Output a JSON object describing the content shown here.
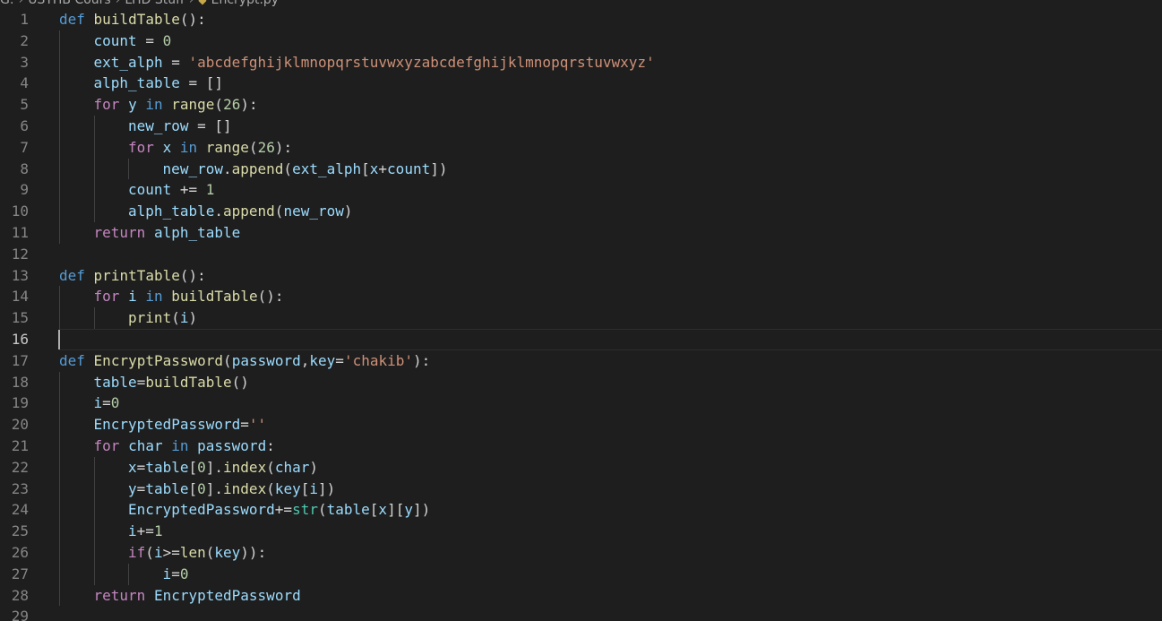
{
  "breadcrumb": {
    "path": [
      "G:",
      "USTHB Cours",
      "LHD Stuff"
    ],
    "file": "Encrypt.py"
  },
  "editor": {
    "current_line": 16,
    "lines": [
      {
        "n": "1",
        "indent": 0,
        "tokens": [
          [
            "kw",
            "def"
          ],
          [
            "pl",
            " "
          ],
          [
            "fn",
            "buildTable"
          ],
          [
            "pl",
            "():"
          ]
        ]
      },
      {
        "n": "2",
        "indent": 1,
        "tokens": [
          [
            "var",
            "count"
          ],
          [
            "pl",
            " = "
          ],
          [
            "num",
            "0"
          ]
        ]
      },
      {
        "n": "3",
        "indent": 1,
        "tokens": [
          [
            "var",
            "ext_alph"
          ],
          [
            "pl",
            " = "
          ],
          [
            "str",
            "'abcdefghijklmnopqrstuvwxyzabcdefghijklmnopqrstuvwxyz'"
          ]
        ]
      },
      {
        "n": "4",
        "indent": 1,
        "tokens": [
          [
            "var",
            "alph_table"
          ],
          [
            "pl",
            " = []"
          ]
        ]
      },
      {
        "n": "5",
        "indent": 1,
        "tokens": [
          [
            "ctl",
            "for"
          ],
          [
            "pl",
            " "
          ],
          [
            "var",
            "y"
          ],
          [
            "pl",
            " "
          ],
          [
            "kw",
            "in"
          ],
          [
            "pl",
            " "
          ],
          [
            "fn",
            "range"
          ],
          [
            "pl",
            "("
          ],
          [
            "num",
            "26"
          ],
          [
            "pl",
            "):"
          ]
        ]
      },
      {
        "n": "6",
        "indent": 2,
        "tokens": [
          [
            "var",
            "new_row"
          ],
          [
            "pl",
            " = []"
          ]
        ]
      },
      {
        "n": "7",
        "indent": 2,
        "tokens": [
          [
            "ctl",
            "for"
          ],
          [
            "pl",
            " "
          ],
          [
            "var",
            "x"
          ],
          [
            "pl",
            " "
          ],
          [
            "kw",
            "in"
          ],
          [
            "pl",
            " "
          ],
          [
            "fn",
            "range"
          ],
          [
            "pl",
            "("
          ],
          [
            "num",
            "26"
          ],
          [
            "pl",
            "):"
          ]
        ]
      },
      {
        "n": "8",
        "indent": 3,
        "tokens": [
          [
            "var",
            "new_row"
          ],
          [
            "pl",
            "."
          ],
          [
            "fn",
            "append"
          ],
          [
            "pl",
            "("
          ],
          [
            "var",
            "ext_alph"
          ],
          [
            "pl",
            "["
          ],
          [
            "var",
            "x"
          ],
          [
            "pl",
            "+"
          ],
          [
            "var",
            "count"
          ],
          [
            "pl",
            "])"
          ]
        ]
      },
      {
        "n": "9",
        "indent": 2,
        "tokens": [
          [
            "var",
            "count"
          ],
          [
            "pl",
            " += "
          ],
          [
            "num",
            "1"
          ]
        ]
      },
      {
        "n": "10",
        "indent": 2,
        "tokens": [
          [
            "var",
            "alph_table"
          ],
          [
            "pl",
            "."
          ],
          [
            "fn",
            "append"
          ],
          [
            "pl",
            "("
          ],
          [
            "var",
            "new_row"
          ],
          [
            "pl",
            ")"
          ]
        ]
      },
      {
        "n": "11",
        "indent": 1,
        "tokens": [
          [
            "ctl",
            "return"
          ],
          [
            "pl",
            " "
          ],
          [
            "var",
            "alph_table"
          ]
        ]
      },
      {
        "n": "12",
        "indent": 0,
        "tokens": []
      },
      {
        "n": "13",
        "indent": 0,
        "tokens": [
          [
            "kw",
            "def"
          ],
          [
            "pl",
            " "
          ],
          [
            "fn",
            "printTable"
          ],
          [
            "pl",
            "():"
          ]
        ]
      },
      {
        "n": "14",
        "indent": 1,
        "tokens": [
          [
            "ctl",
            "for"
          ],
          [
            "pl",
            " "
          ],
          [
            "var",
            "i"
          ],
          [
            "pl",
            " "
          ],
          [
            "kw",
            "in"
          ],
          [
            "pl",
            " "
          ],
          [
            "fn",
            "buildTable"
          ],
          [
            "pl",
            "():"
          ]
        ]
      },
      {
        "n": "15",
        "indent": 2,
        "tokens": [
          [
            "fn",
            "print"
          ],
          [
            "pl",
            "("
          ],
          [
            "var",
            "i"
          ],
          [
            "pl",
            ")"
          ]
        ]
      },
      {
        "n": "16",
        "indent": 0,
        "tokens": []
      },
      {
        "n": "17",
        "indent": 0,
        "tokens": [
          [
            "kw",
            "def"
          ],
          [
            "pl",
            " "
          ],
          [
            "fn",
            "EncryptPassword"
          ],
          [
            "pl",
            "("
          ],
          [
            "var",
            "password"
          ],
          [
            "pl",
            ","
          ],
          [
            "var",
            "key"
          ],
          [
            "pl",
            "="
          ],
          [
            "str",
            "'chakib'"
          ],
          [
            "pl",
            "):"
          ]
        ]
      },
      {
        "n": "18",
        "indent": 1,
        "tokens": [
          [
            "var",
            "table"
          ],
          [
            "pl",
            "="
          ],
          [
            "fn",
            "buildTable"
          ],
          [
            "pl",
            "()"
          ]
        ]
      },
      {
        "n": "19",
        "indent": 1,
        "tokens": [
          [
            "var",
            "i"
          ],
          [
            "pl",
            "="
          ],
          [
            "num",
            "0"
          ]
        ]
      },
      {
        "n": "20",
        "indent": 1,
        "tokens": [
          [
            "var",
            "EncryptedPassword"
          ],
          [
            "pl",
            "="
          ],
          [
            "str",
            "''"
          ]
        ]
      },
      {
        "n": "21",
        "indent": 1,
        "tokens": [
          [
            "ctl",
            "for"
          ],
          [
            "pl",
            " "
          ],
          [
            "var",
            "char"
          ],
          [
            "pl",
            " "
          ],
          [
            "kw",
            "in"
          ],
          [
            "pl",
            " "
          ],
          [
            "var",
            "password"
          ],
          [
            "pl",
            ":"
          ]
        ]
      },
      {
        "n": "22",
        "indent": 2,
        "tokens": [
          [
            "var",
            "x"
          ],
          [
            "pl",
            "="
          ],
          [
            "var",
            "table"
          ],
          [
            "pl",
            "["
          ],
          [
            "num",
            "0"
          ],
          [
            "pl",
            "]."
          ],
          [
            "fn",
            "index"
          ],
          [
            "pl",
            "("
          ],
          [
            "var",
            "char"
          ],
          [
            "pl",
            ")"
          ]
        ]
      },
      {
        "n": "23",
        "indent": 2,
        "tokens": [
          [
            "var",
            "y"
          ],
          [
            "pl",
            "="
          ],
          [
            "var",
            "table"
          ],
          [
            "pl",
            "["
          ],
          [
            "num",
            "0"
          ],
          [
            "pl",
            "]."
          ],
          [
            "fn",
            "index"
          ],
          [
            "pl",
            "("
          ],
          [
            "var",
            "key"
          ],
          [
            "pl",
            "["
          ],
          [
            "var",
            "i"
          ],
          [
            "pl",
            "])"
          ]
        ]
      },
      {
        "n": "24",
        "indent": 2,
        "tokens": [
          [
            "var",
            "EncryptedPassword"
          ],
          [
            "pl",
            "+="
          ],
          [
            "bi",
            "str"
          ],
          [
            "pl",
            "("
          ],
          [
            "var",
            "table"
          ],
          [
            "pl",
            "["
          ],
          [
            "var",
            "x"
          ],
          [
            "pl",
            "]["
          ],
          [
            "var",
            "y"
          ],
          [
            "pl",
            "])"
          ]
        ]
      },
      {
        "n": "25",
        "indent": 2,
        "tokens": [
          [
            "var",
            "i"
          ],
          [
            "pl",
            "+="
          ],
          [
            "num",
            "1"
          ]
        ]
      },
      {
        "n": "26",
        "indent": 2,
        "tokens": [
          [
            "ctl",
            "if"
          ],
          [
            "pl",
            "("
          ],
          [
            "var",
            "i"
          ],
          [
            "pl",
            ">="
          ],
          [
            "fn",
            "len"
          ],
          [
            "pl",
            "("
          ],
          [
            "var",
            "key"
          ],
          [
            "pl",
            "))"
          ],
          [
            "pl",
            ":"
          ]
        ]
      },
      {
        "n": "27",
        "indent": 3,
        "tokens": [
          [
            "var",
            "i"
          ],
          [
            "pl",
            "="
          ],
          [
            "num",
            "0"
          ]
        ]
      },
      {
        "n": "28",
        "indent": 1,
        "tokens": [
          [
            "ctl",
            "return"
          ],
          [
            "pl",
            " "
          ],
          [
            "var",
            "EncryptedPassword"
          ]
        ]
      },
      {
        "n": "29",
        "indent": 0,
        "tokens": []
      }
    ]
  }
}
